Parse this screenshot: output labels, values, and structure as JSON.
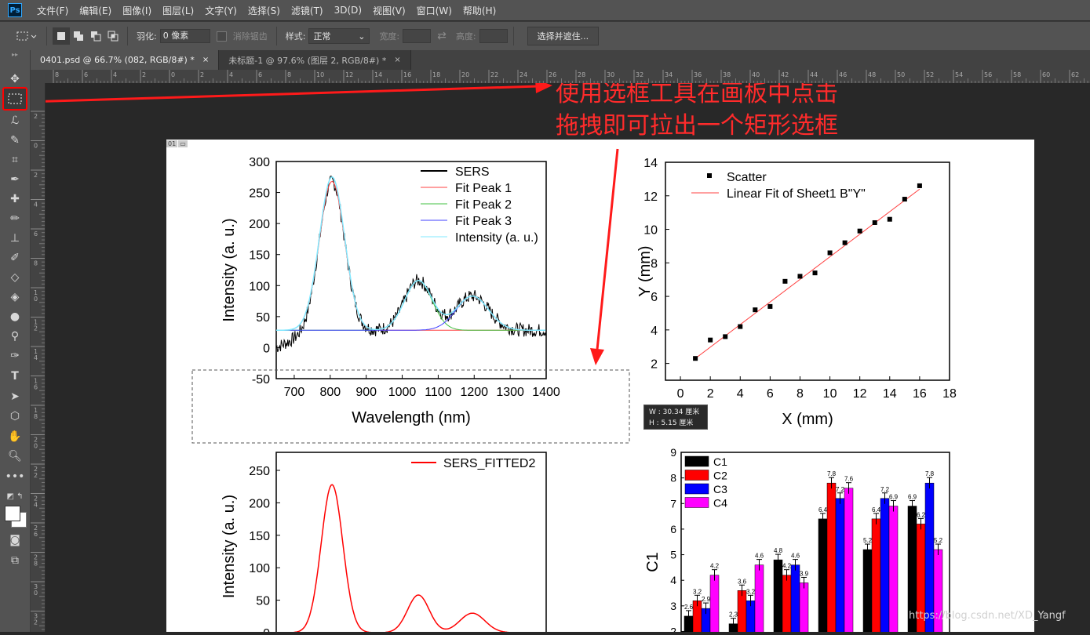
{
  "app": {
    "logo": "Ps"
  },
  "menu": [
    "文件(F)",
    "编辑(E)",
    "图像(I)",
    "图层(L)",
    "文字(Y)",
    "选择(S)",
    "滤镜(T)",
    "3D(D)",
    "视图(V)",
    "窗口(W)",
    "帮助(H)"
  ],
  "options": {
    "feather_label": "羽化:",
    "feather_value": "0 像素",
    "antialias_label": "消除锯齿",
    "style_label": "样式:",
    "style_value": "正常",
    "width_label": "宽度:",
    "height_label": "高度:",
    "select_mask_button": "选择并遮住..."
  },
  "tabs": [
    {
      "label": "0401.psd @ 66.7% (082, RGB/8#) *",
      "close": "×"
    },
    {
      "label": "未标题-1 @ 97.6% (图层 2, RGB/8#) *",
      "close": "×"
    }
  ],
  "ruler": {
    "h_labels": [
      "8",
      "6",
      "4",
      "2",
      "0",
      "2",
      "4",
      "6",
      "8",
      "10",
      "12",
      "14",
      "16",
      "18",
      "20",
      "22",
      "24",
      "26",
      "28",
      "30",
      "32",
      "34",
      "36",
      "38",
      "40",
      "42",
      "44",
      "46",
      "48",
      "50",
      "52",
      "54",
      "56",
      "58",
      "60",
      "62"
    ],
    "v_labels": [
      "2",
      "0",
      "2",
      "4",
      "6",
      "8",
      "1 0",
      "1 2",
      "1 4",
      "1 6",
      "1 8",
      "2 0",
      "2 2",
      "2 4",
      "2 6",
      "2 8",
      "3 0",
      "3 2"
    ]
  },
  "artboard": {
    "label": "01"
  },
  "annotation": {
    "line1": "使用选框工具在画板中点击",
    "line2": "拖拽即可拉出一个矩形选框"
  },
  "selection_info": {
    "w": "W :  30.34 厘米",
    "h": "H :    5.15 厘米"
  },
  "watermark": "https://blog.csdn.net/XD_Yangf",
  "chart_data": [
    {
      "type": "line",
      "ylabel": "Intensity (a. u.)",
      "xlabel": "Wavelength (nm)",
      "xlim": [
        650,
        1400
      ],
      "ylim": [
        -50,
        300
      ],
      "xticks": [
        "700",
        "800",
        "900",
        "1000",
        "1100",
        "1200",
        "1300",
        "1400"
      ],
      "yticks": [
        "-50",
        "0",
        "50",
        "100",
        "150",
        "200",
        "250",
        "300"
      ],
      "legend": {
        "position": "top-right"
      },
      "series": [
        {
          "name": "SERS",
          "color": "#000000"
        },
        {
          "name": "Fit Peak 1",
          "color": "#ff4040"
        },
        {
          "name": "Fit Peak 2",
          "color": "#40c040"
        },
        {
          "name": "Fit Peak 3",
          "color": "#4040ff"
        },
        {
          "name": "Intensity (a. u.)",
          "color": "#80e8ff"
        }
      ],
      "peaks": [
        {
          "center": 805,
          "height": 240,
          "sigma": 35
        },
        {
          "center": 1045,
          "height": 80,
          "sigma": 38
        },
        {
          "center": 1195,
          "height": 55,
          "sigma": 45
        }
      ],
      "baseline": 28
    },
    {
      "type": "scatter",
      "xlabel": "X (mm)",
      "ylabel": "Y (mm)",
      "xlim": [
        -1,
        18
      ],
      "ylim": [
        1,
        14
      ],
      "xticks": [
        "0",
        "2",
        "4",
        "6",
        "8",
        "10",
        "12",
        "14",
        "16",
        "18"
      ],
      "yticks": [
        "2",
        "4",
        "6",
        "8",
        "10",
        "12",
        "14"
      ],
      "legend": {
        "position": "top-left"
      },
      "series": [
        {
          "name": "Scatter",
          "x": [
            1,
            2,
            3,
            4,
            5,
            6,
            7,
            8,
            9,
            10,
            11,
            12,
            13,
            14,
            15,
            16
          ],
          "y": [
            2.3,
            3.4,
            3.6,
            4.2,
            5.2,
            5.4,
            6.9,
            7.2,
            7.4,
            8.6,
            9.2,
            9.9,
            10.4,
            10.6,
            11.8,
            12.6
          ]
        },
        {
          "name": "Linear Fit of Sheet1 B\"Y\"",
          "x": [
            1,
            16
          ],
          "y": [
            2.3,
            12.4
          ]
        }
      ]
    },
    {
      "type": "line",
      "ylabel": "Intensity (a. u.)",
      "xlim": [
        650,
        1400
      ],
      "ylim": [
        0,
        250
      ],
      "yticks": [
        "0",
        "50",
        "100",
        "150",
        "200",
        "250"
      ],
      "legend": {
        "position": "top-right"
      },
      "series": [
        {
          "name": "SERS_FITTED2",
          "color": "#ff0000"
        }
      ],
      "peaks": [
        {
          "center": 805,
          "height": 228,
          "sigma": 30
        },
        {
          "center": 1045,
          "height": 58,
          "sigma": 30
        },
        {
          "center": 1195,
          "height": 30,
          "sigma": 35
        }
      ]
    },
    {
      "type": "bar",
      "ylabel": "C1",
      "ylim": [
        1.5,
        9
      ],
      "yticks": [
        "2",
        "3",
        "4",
        "5",
        "6",
        "7",
        "8",
        "9"
      ],
      "legend": {
        "position": "top-left"
      },
      "series": [
        {
          "name": "C1",
          "color": "#000000",
          "values": [
            2.6,
            2.3,
            4.8,
            6.4,
            5.2,
            6.9
          ]
        },
        {
          "name": "C2",
          "color": "#ff0000",
          "values": [
            3.2,
            3.6,
            4.2,
            7.8,
            6.4,
            6.2
          ]
        },
        {
          "name": "C3",
          "color": "#0000ff",
          "values": [
            2.9,
            3.2,
            4.6,
            7.2,
            7.2,
            7.8
          ]
        },
        {
          "name": "C4",
          "color": "#ff00ff",
          "values": [
            4.2,
            4.6,
            3.9,
            7.6,
            6.9,
            5.2
          ]
        }
      ]
    }
  ]
}
